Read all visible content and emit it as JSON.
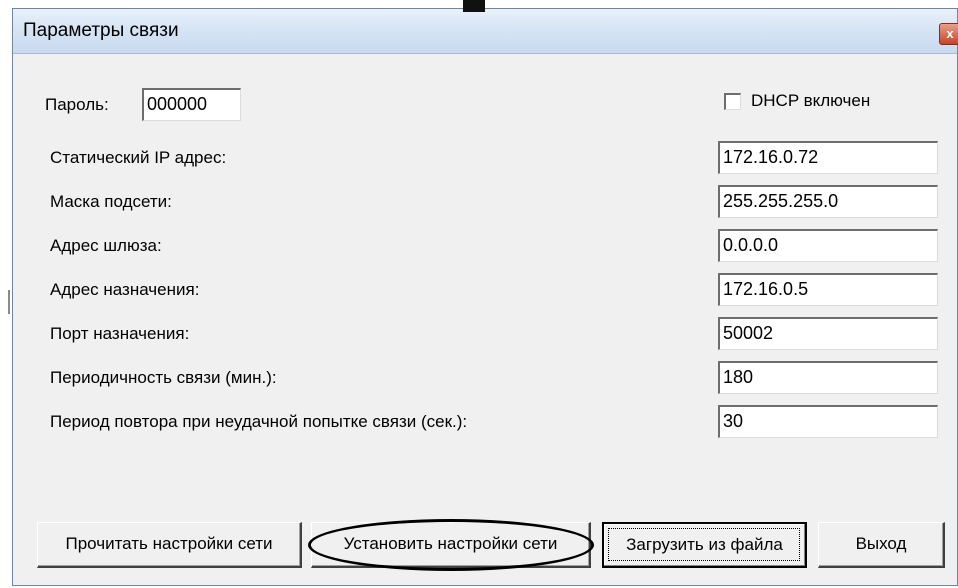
{
  "window": {
    "title": "Параметры связи",
    "close_glyph": "x"
  },
  "form": {
    "password_label": "Пароль:",
    "password_value": "000000",
    "dhcp_label": "DHCP включен",
    "dhcp_checked": false,
    "rows": [
      {
        "label": "Статический IP адрес:",
        "value": "172.16.0.72"
      },
      {
        "label": "Маска подсети:",
        "value": "255.255.255.0"
      },
      {
        "label": "Адрес шлюза:",
        "value": "0.0.0.0"
      },
      {
        "label": "Адрес назначения:",
        "value": "172.16.0.5"
      },
      {
        "label": "Порт назначения:",
        "value": "50002"
      },
      {
        "label": "Периодичность связи (мин.):",
        "value": "180"
      },
      {
        "label": "Период повтора при неудачной попытке связи (сек.):",
        "value": "30"
      }
    ]
  },
  "buttons": {
    "read": "Прочитать настройки сети",
    "set": "Установить настройки сети",
    "load": "Загрузить из файла",
    "exit": "Выход"
  },
  "colors": {
    "title_bar": "#d7e4f4",
    "dialog_bg": "#f0f0f0",
    "close_button": "#c7432a"
  }
}
